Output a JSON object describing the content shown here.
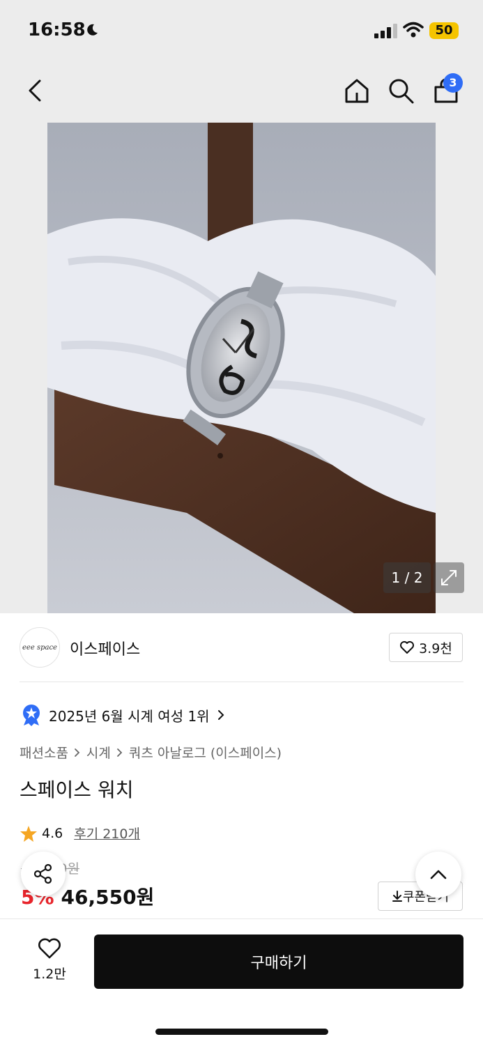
{
  "status_bar": {
    "time": "16:58",
    "battery": "50"
  },
  "nav": {
    "cart_count": "3"
  },
  "gallery": {
    "counter": "1 / 2"
  },
  "brand": {
    "logo_text": "eee space",
    "name": "이스페이스",
    "likes": "3.9천"
  },
  "ranking": {
    "text": "2025년 6월 시계 여성 1위"
  },
  "breadcrumb": [
    "패션소품",
    "시계",
    "쿼츠 아날로그 (이스페이스)"
  ],
  "product": {
    "title": "스페이스 워치",
    "rating": "4.6",
    "reviews": "후기 210개",
    "original_price": "49,000원",
    "discount": "5%",
    "price": "46,550원",
    "coupon_label": "쿠폰받기"
  },
  "bottom": {
    "wish_count": "1.2만",
    "buy_label": "구매하기"
  },
  "colors": {
    "accent": "#2f6df6",
    "discount": "#e8242b",
    "star": "#f5a623",
    "battery": "#f5c400"
  },
  "icons": [
    "moon-icon",
    "signal-icon",
    "wifi-icon",
    "back-icon",
    "home-icon",
    "search-icon",
    "cart-icon",
    "expand-icon",
    "heart-icon",
    "medal-icon",
    "chevron-right-icon",
    "star-icon",
    "share-icon",
    "chevron-up-icon",
    "download-icon"
  ]
}
